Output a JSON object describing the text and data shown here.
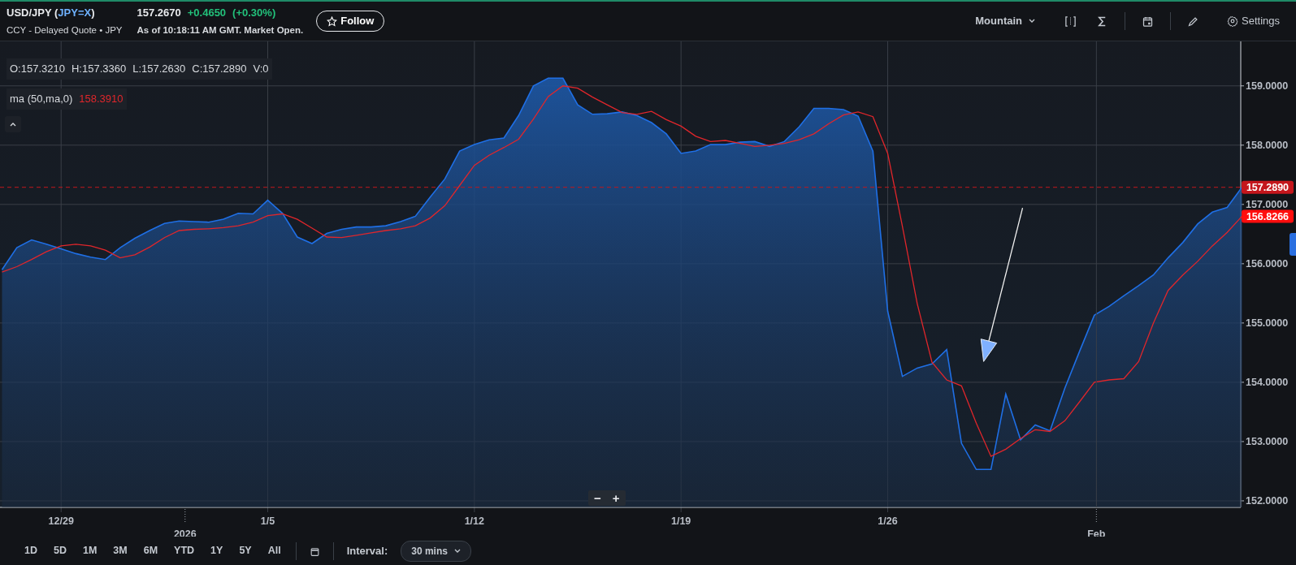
{
  "header": {
    "title_parts": [
      {
        "text": " (",
        "kind": "plain"
      },
      {
        "text": "JPY=X",
        "kind": "link"
      },
      {
        "text": ")",
        "kind": "plain"
      }
    ],
    "subtitle": "CCY - Delayed Quote • JPY",
    "price": "157.2670",
    "change": "+0.4650",
    "change_pct": "(+0.30%)",
    "as_of": "As of 10:18:11 AM GMT. Market Open.",
    "follow_button": "Follow"
  },
  "toolbar": {
    "chart_type": "Mountain",
    "tools": [
      {
        "kind": "bracket"
      },
      {
        "kind": "sigma"
      },
      {
        "kind": "calendar"
      },
      {
        "kind": "pencil"
      }
    ],
    "settings": "Settings"
  },
  "chart": {
    "ohlc": [
      "O:157.3210",
      "H:157.3360",
      "L:157.2630",
      "C:157.2890",
      "V:0"
    ],
    "indicator": {
      "value": "158.3910"
    },
    "ma_tag": "156.8266",
    "zoom_controls": [
      "−",
      "+"
    ],
    "chart_data": {
      "type": "area",
      "grid": true,
      "ref_lines": [
        {
          "axis": "y",
          "value": 157.289,
          "label": "157.2890",
          "color": "#c4161c"
        }
      ],
      "categories": [
        null,
        null,
        null,
        null,
        "12/29",
        null,
        null,
        null,
        null,
        null,
        null,
        null,
        null,
        null,
        null,
        null,
        null,
        null,
        "1/5",
        null,
        null,
        null,
        null,
        null,
        null,
        null,
        null,
        null,
        null,
        null,
        null,
        null,
        "1/12",
        null,
        null,
        null,
        null,
        null,
        null,
        null,
        null,
        null,
        null,
        null,
        null,
        null,
        "1/19",
        null,
        null,
        null,
        null,
        null,
        null,
        null,
        null,
        null,
        null,
        null,
        null,
        null,
        "1/26",
        null,
        null,
        null,
        null,
        null,
        null,
        null,
        null,
        null,
        null,
        null,
        null,
        null,
        null,
        null,
        null,
        null,
        null,
        null,
        null,
        null,
        null,
        null,
        null
      ],
      "series": [
        {
          "name": "USD/JPY",
          "color": "#1f6fe5",
          "values": [
            155.9,
            156.27,
            156.4,
            156.33,
            156.25,
            156.17,
            156.11,
            156.07,
            156.27,
            156.43,
            156.56,
            156.68,
            156.72,
            156.71,
            156.7,
            156.75,
            156.85,
            156.84,
            157.07,
            156.85,
            156.45,
            156.34,
            156.51,
            156.58,
            156.62,
            156.62,
            156.64,
            156.71,
            156.8,
            157.12,
            157.43,
            157.9,
            158.01,
            158.09,
            158.12,
            158.5,
            159.0,
            159.13,
            159.13,
            158.68,
            158.52,
            158.53,
            158.56,
            158.5,
            158.38,
            158.19,
            157.86,
            157.9,
            158.01,
            158.01,
            158.05,
            158.06,
            157.98,
            158.06,
            158.31,
            158.62,
            158.62,
            158.6,
            158.49,
            157.9,
            155.2,
            154.1,
            154.24,
            154.31,
            154.55,
            152.97,
            152.53,
            152.53,
            153.8,
            153.03,
            153.28,
            153.18,
            153.9,
            154.52,
            155.13,
            155.28,
            155.46,
            155.63,
            155.81,
            156.1,
            156.36,
            156.67,
            156.87,
            156.95,
            157.29
          ]
        },
        {
          "name": "ma (50,ma,0)",
          "type": "line",
          "color": "#e0262b",
          "values": [
            155.86,
            155.95,
            156.07,
            156.2,
            156.3,
            156.33,
            156.3,
            156.23,
            156.1,
            156.15,
            156.28,
            156.44,
            156.56,
            156.58,
            156.59,
            156.61,
            156.64,
            156.7,
            156.81,
            156.84,
            156.75,
            156.6,
            156.45,
            156.44,
            156.48,
            156.52,
            156.56,
            156.59,
            156.64,
            156.77,
            156.98,
            157.32,
            157.66,
            157.83,
            157.96,
            158.1,
            158.44,
            158.82,
            159.0,
            158.96,
            158.81,
            158.68,
            158.55,
            158.52,
            158.57,
            158.43,
            158.32,
            158.15,
            158.06,
            158.08,
            158.03,
            157.98,
            158.0,
            158.03,
            158.09,
            158.19,
            158.36,
            158.51,
            158.56,
            158.48,
            157.86,
            156.63,
            155.33,
            154.34,
            154.04,
            153.94,
            153.31,
            152.75,
            152.87,
            153.05,
            153.2,
            153.17,
            153.35,
            153.67,
            154.0,
            154.04,
            154.06,
            154.35,
            155.0,
            155.55,
            155.81,
            156.04,
            156.3,
            156.53,
            156.8
          ]
        }
      ],
      "ylim": [
        151.89,
        159.75
      ],
      "yticks": [
        {
          "value": 152,
          "label": "152.0000"
        },
        {
          "value": 153,
          "label": "153.0000"
        },
        {
          "value": 154,
          "label": "154.0000"
        },
        {
          "value": 155,
          "label": "155.0000"
        },
        {
          "value": 156,
          "label": "156.0000"
        },
        {
          "value": 157,
          "label": "157.0000"
        },
        {
          "value": 158,
          "label": "158.0000"
        },
        {
          "value": 159,
          "label": "159.0000"
        }
      ],
      "annotations": [
        "2026",
        "Feb"
      ]
    }
  },
  "footer": {
    "ranges": [
      {
        "label": "1D",
        "selected": false
      },
      {
        "label": "5D",
        "selected": false
      },
      {
        "label": "1M",
        "selected": false
      },
      {
        "label": "3M",
        "selected": false
      },
      {
        "label": "6M",
        "selected": false
      },
      {
        "label": "YTD",
        "selected": false
      },
      {
        "label": "1Y",
        "selected": false
      },
      {
        "label": "5Y",
        "selected": false
      },
      {
        "label": "All",
        "selected": false
      }
    ],
    "interval_label": "Interval:",
    "interval": "30 mins"
  }
}
